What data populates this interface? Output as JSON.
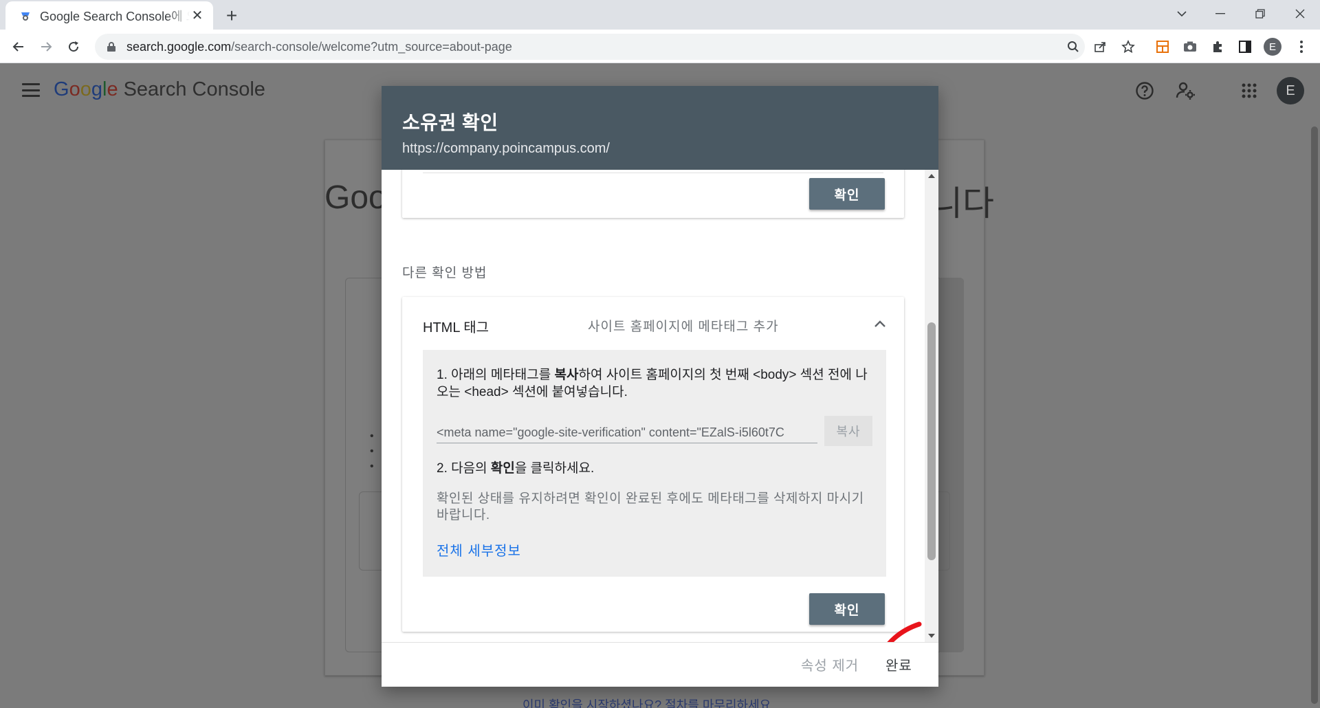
{
  "browser": {
    "tab_title": "Google Search Console에 오신 것을 환영합니다",
    "url_host": "search.google.com",
    "url_path": "/search-console/welcome?utm_source=about-page",
    "profile_initial": "E"
  },
  "app": {
    "logo_google": [
      "G",
      "o",
      "o",
      "g",
      "l",
      "e"
    ],
    "logo_product": "Search Console",
    "avatar_initial": "E"
  },
  "background": {
    "title_left": "Goo",
    "title_right": "니다",
    "link_text": "이미 확인을 시작하셨나요? 절차를 마무리하세요."
  },
  "modal": {
    "title": "소유권 확인",
    "subtitle": "https://company.poincampus.com/",
    "top_confirm_label": "확인",
    "other_methods_label": "다른 확인 방법",
    "html_tag": {
      "title": "HTML 태그",
      "description": "사이트 홈페이지에 메타태그 추가",
      "step1_prefix": "1. 아래의 메타태그를 ",
      "step1_bold": "복사",
      "step1_suffix": "하여 사이트 홈페이지의 첫 번째 <body> 섹션 전에 나오는 <head> 섹션에 붙여넣습니다.",
      "meta_value": "<meta name=\"google-site-verification\" content=\"EZalS-i5l60t7C",
      "copy_label": "복사",
      "step2_prefix": "2. 다음의 ",
      "step2_bold": "확인",
      "step2_suffix": "을 클릭하세요.",
      "note": "확인된 상태를 유지하려면 확인이 완료된 후에도 메타태그를 삭제하지 마시기 바랍니다.",
      "details_link": "전체 세부정보",
      "confirm_label": "확인"
    },
    "footer": {
      "remove_property_label": "속성 제거",
      "done_label": "완료"
    }
  },
  "colors": {
    "modal_header": "#4a5963",
    "confirm_button": "#5c6f7c",
    "link": "#1a73e8",
    "annotation_check": "#e8141b"
  }
}
